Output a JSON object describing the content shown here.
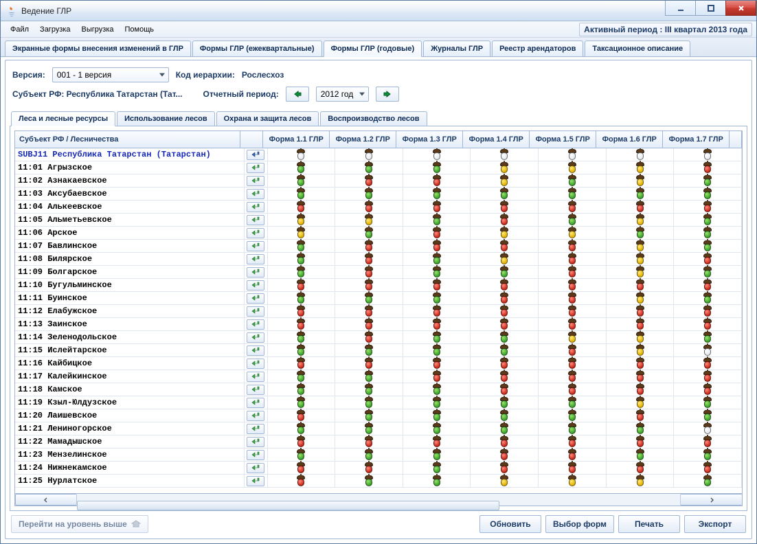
{
  "window": {
    "title": "Ведение ГЛР"
  },
  "menu": {
    "items": [
      "Файл",
      "Загрузка",
      "Выгрузка",
      "Помощь"
    ]
  },
  "status": {
    "active_period": "Активный период : III квартал  2013 года"
  },
  "main_tabs": [
    "Экранные формы внесения изменений в ГЛР",
    "Формы ГЛР (ежеквартальные)",
    "Формы ГЛР (годовые)",
    "Журналы ГЛР",
    "Реестр арендаторов",
    "Таксационное описание"
  ],
  "main_tabs_active_index": 2,
  "filters": {
    "version_label": "Версия:",
    "version_value": "001 - 1 версия",
    "hierarchy_label": "Код иерархии:",
    "hierarchy_value": "Рослесхоз",
    "subject_label": "Субъект РФ: Республика Татарстан (Тат...",
    "period_label": "Отчетный период:",
    "period_value": "2012 год"
  },
  "sub_tabs": [
    "Леса и лесные ресурсы",
    "Использование лесов",
    "Охрана и защита лесов",
    "Воспроизводство лесов"
  ],
  "sub_tabs_active_index": 0,
  "table": {
    "header_left": "Субъект РФ / Лесничества",
    "form_columns": [
      "Форма 1.1 ГЛР",
      "Форма 1.2 ГЛР",
      "Форма 1.3 ГЛР",
      "Форма 1.4 ГЛР",
      "Форма 1.5 ГЛР",
      "Форма 1.6 ГЛР",
      "Форма 1.7 ГЛР"
    ],
    "status_colors": {
      "g": "green",
      "y": "yellow",
      "r": "red",
      "w": "white"
    },
    "rows": [
      {
        "kind": "subject",
        "name": "SUBJ11 Республика Татарстан (Татарстан)",
        "enter": "blue",
        "cells": [
          "w",
          "w",
          "w",
          "w",
          "w",
          "w",
          "w"
        ]
      },
      {
        "kind": "unit",
        "name": "11:01 Агрызское",
        "enter": "green",
        "cells": [
          "g",
          "g",
          "g",
          "y",
          "y",
          "y",
          "r"
        ]
      },
      {
        "kind": "unit",
        "name": "11:02 Азнакаевское",
        "enter": "green",
        "cells": [
          "g",
          "r",
          "r",
          "y",
          "g",
          "y",
          "g"
        ]
      },
      {
        "kind": "unit",
        "name": "11:03 Аксубаевское",
        "enter": "green",
        "cells": [
          "g",
          "g",
          "g",
          "g",
          "g",
          "g",
          "g"
        ]
      },
      {
        "kind": "unit",
        "name": "11:04 Алькеевское",
        "enter": "green",
        "cells": [
          "r",
          "r",
          "r",
          "r",
          "r",
          "r",
          "r"
        ]
      },
      {
        "kind": "unit",
        "name": "11:05 Альметьевское",
        "enter": "green",
        "cells": [
          "y",
          "y",
          "g",
          "r",
          "g",
          "y",
          "g"
        ]
      },
      {
        "kind": "unit",
        "name": "11:06 Арское",
        "enter": "green",
        "cells": [
          "y",
          "g",
          "r",
          "y",
          "y",
          "g",
          "g"
        ]
      },
      {
        "kind": "unit",
        "name": "11:07 Бавлинское",
        "enter": "green",
        "cells": [
          "g",
          "r",
          "r",
          "r",
          "r",
          "y",
          "g"
        ]
      },
      {
        "kind": "unit",
        "name": "11:08 Билярское",
        "enter": "green",
        "cells": [
          "g",
          "r",
          "g",
          "y",
          "r",
          "y",
          "r"
        ]
      },
      {
        "kind": "unit",
        "name": "11:09 Болгарское",
        "enter": "green",
        "cells": [
          "g",
          "r",
          "g",
          "g",
          "r",
          "y",
          "g"
        ]
      },
      {
        "kind": "unit",
        "name": "11:10 Бугульминское",
        "enter": "green",
        "cells": [
          "r",
          "r",
          "r",
          "r",
          "r",
          "r",
          "r"
        ]
      },
      {
        "kind": "unit",
        "name": "11:11 Буинское",
        "enter": "green",
        "cells": [
          "g",
          "g",
          "g",
          "r",
          "r",
          "y",
          "g"
        ]
      },
      {
        "kind": "unit",
        "name": "11:12 Елабужское",
        "enter": "green",
        "cells": [
          "r",
          "r",
          "r",
          "r",
          "r",
          "r",
          "r"
        ]
      },
      {
        "kind": "unit",
        "name": "11:13 Заинское",
        "enter": "green",
        "cells": [
          "r",
          "r",
          "r",
          "r",
          "r",
          "r",
          "r"
        ]
      },
      {
        "kind": "unit",
        "name": "11:14 Зеленодольское",
        "enter": "green",
        "cells": [
          "g",
          "r",
          "g",
          "g",
          "y",
          "y",
          "g"
        ]
      },
      {
        "kind": "unit",
        "name": "11:15 Ислейтарское",
        "enter": "green",
        "cells": [
          "g",
          "g",
          "g",
          "g",
          "r",
          "y",
          "w"
        ]
      },
      {
        "kind": "unit",
        "name": "11:16 Кайбицкое",
        "enter": "green",
        "cells": [
          "r",
          "r",
          "r",
          "r",
          "r",
          "r",
          "r"
        ]
      },
      {
        "kind": "unit",
        "name": "11:17 Калейкинское",
        "enter": "green",
        "cells": [
          "g",
          "g",
          "r",
          "r",
          "r",
          "r",
          "r"
        ]
      },
      {
        "kind": "unit",
        "name": "11:18 Камское",
        "enter": "green",
        "cells": [
          "g",
          "g",
          "g",
          "r",
          "r",
          "r",
          "r"
        ]
      },
      {
        "kind": "unit",
        "name": "11:19 Кзыл-Юлдузское",
        "enter": "green",
        "cells": [
          "g",
          "g",
          "g",
          "g",
          "g",
          "y",
          "g"
        ]
      },
      {
        "kind": "unit",
        "name": "11:20 Лаишевское",
        "enter": "green",
        "cells": [
          "r",
          "g",
          "g",
          "g",
          "g",
          "r",
          "g"
        ]
      },
      {
        "kind": "unit",
        "name": "11:21 Лениногорское",
        "enter": "green",
        "cells": [
          "g",
          "g",
          "g",
          "g",
          "g",
          "g",
          "w"
        ]
      },
      {
        "kind": "unit",
        "name": "11:22 Мамадышское",
        "enter": "green",
        "cells": [
          "r",
          "r",
          "r",
          "r",
          "r",
          "r",
          "r"
        ]
      },
      {
        "kind": "unit",
        "name": "11:23 Мензелинское",
        "enter": "green",
        "cells": [
          "g",
          "g",
          "g",
          "r",
          "r",
          "g",
          "g"
        ]
      },
      {
        "kind": "unit",
        "name": "11:24 Нижнекамское",
        "enter": "green",
        "cells": [
          "r",
          "r",
          "g",
          "r",
          "r",
          "r",
          "r"
        ]
      },
      {
        "kind": "unit",
        "name": "11:25 Нурлатское",
        "enter": "green",
        "cells": [
          "r",
          "g",
          "g",
          "y",
          "y",
          "y",
          "g"
        ]
      }
    ]
  },
  "footer": {
    "up_level": "Перейти на уровень выше",
    "buttons": [
      "Обновить",
      "Выбор форм",
      "Печать",
      "Экспорт"
    ]
  }
}
